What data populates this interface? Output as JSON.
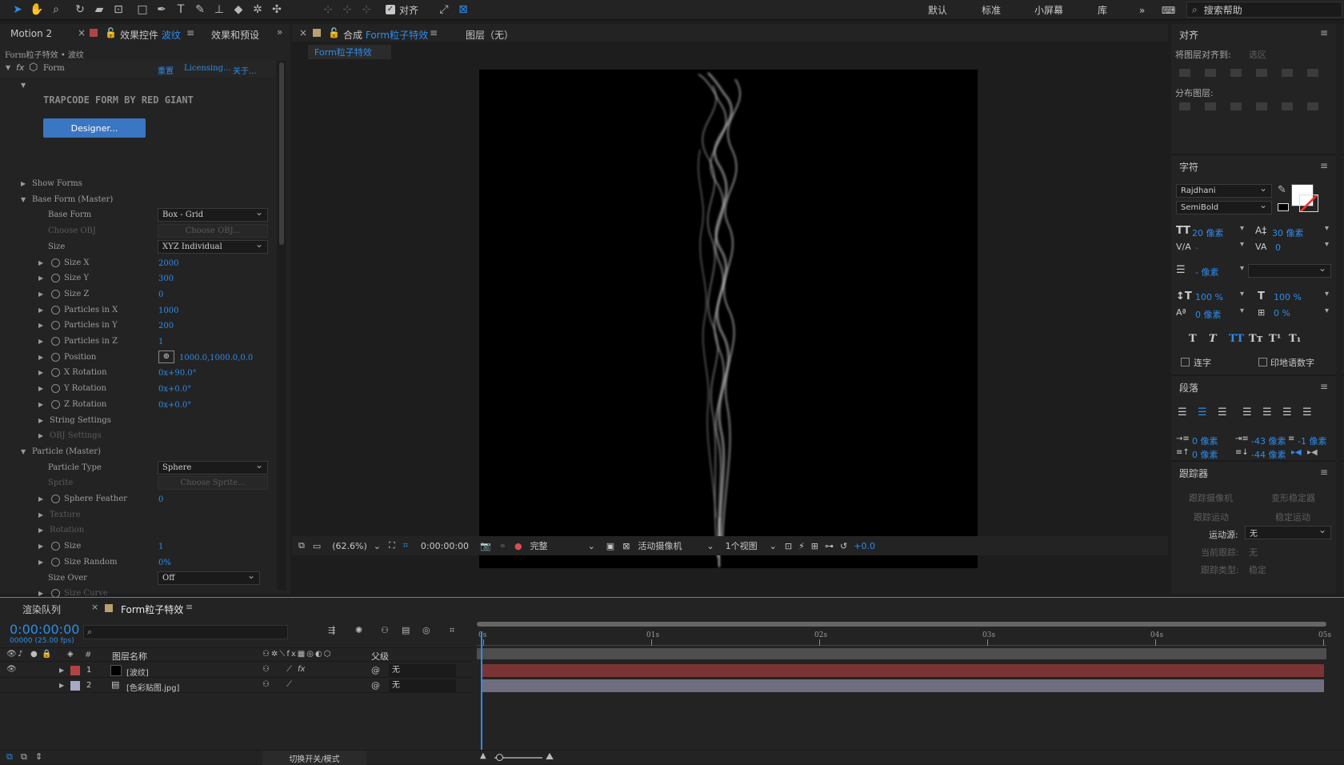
{
  "toolbar": {
    "align_label": "对齐",
    "workspaces": [
      "默认",
      "标准",
      "小屏幕",
      "库"
    ],
    "search_placeholder": "搜索帮助"
  },
  "left_panel": {
    "tab1": "Motion 2",
    "tab2_prefix": "效果控件",
    "tab2_layer": "波纹",
    "tab3": "效果和预设",
    "breadcrumb": "Form粒子特效 • 波纹",
    "effect_name": "Form",
    "reset": "重置",
    "licensing": "Licensing...",
    "about": "关于...",
    "logo_text": "TRAPCODE FORM BY RED GIANT",
    "designer_btn": "Designer...",
    "props": [
      {
        "label": "Show Forms",
        "kind": "group",
        "indent": 1
      },
      {
        "label": "Base Form (Master)",
        "kind": "open",
        "indent": 1
      },
      {
        "label": "Base Form",
        "kind": "dropdown",
        "value": "Box - Grid",
        "indent": 2
      },
      {
        "label": "Choose OBJ",
        "kind": "button",
        "value": "Choose OBJ...",
        "dim": true,
        "indent": 2
      },
      {
        "label": "Size",
        "kind": "dropdown",
        "value": "XYZ Individual",
        "indent": 2
      },
      {
        "label": "Size X",
        "kind": "num",
        "value": "2000",
        "indent": 3
      },
      {
        "label": "Size Y",
        "kind": "num",
        "value": "300",
        "indent": 3
      },
      {
        "label": "Size Z",
        "kind": "num",
        "value": "0",
        "indent": 3
      },
      {
        "label": "Particles in X",
        "kind": "num",
        "value": "1000",
        "indent": 3
      },
      {
        "label": "Particles in Y",
        "kind": "num",
        "value": "200",
        "indent": 3
      },
      {
        "label": "Particles in Z",
        "kind": "num",
        "value": "1",
        "indent": 3
      },
      {
        "label": "Position",
        "kind": "pos",
        "value": "1000.0,1000.0,0.0",
        "indent": 3
      },
      {
        "label": "X Rotation",
        "kind": "num",
        "value": "0x+90.0°",
        "indent": 3
      },
      {
        "label": "Y Rotation",
        "kind": "num",
        "value": "0x+0.0°",
        "indent": 3
      },
      {
        "label": "Z Rotation",
        "kind": "num",
        "value": "0x+0.0°",
        "indent": 3
      },
      {
        "label": "String Settings",
        "kind": "group",
        "indent": 2
      },
      {
        "label": "OBJ Settings",
        "kind": "group",
        "dim": true,
        "indent": 2
      },
      {
        "label": "Particle (Master)",
        "kind": "open",
        "indent": 1
      },
      {
        "label": "Particle Type",
        "kind": "dropdown",
        "value": "Sphere",
        "indent": 2
      },
      {
        "label": "Sprite",
        "kind": "button",
        "value": "Choose Sprite...",
        "dim": true,
        "indent": 2
      },
      {
        "label": "Sphere Feather",
        "kind": "num",
        "value": "0",
        "indent": 3
      },
      {
        "label": "Texture",
        "kind": "group",
        "dim": true,
        "indent": 2
      },
      {
        "label": "Rotation",
        "kind": "group",
        "dim": true,
        "indent": 2
      },
      {
        "label": "Size",
        "kind": "num",
        "value": "1",
        "indent": 3
      },
      {
        "label": "Size Random",
        "kind": "num",
        "value": "0%",
        "indent": 3
      },
      {
        "label": "Size Over",
        "kind": "dropdown",
        "value": "Off",
        "indent": 2
      },
      {
        "label": "Size Curve",
        "kind": "num",
        "value": "",
        "dim": true,
        "indent": 3
      }
    ]
  },
  "comp_panel": {
    "tab_prefix": "合成",
    "tab_name": "Form粒子特效",
    "layer_tab": "图层（无）",
    "sub_tab": "Form粒子特效",
    "zoom": "(62.6%)",
    "timecode": "0:00:00:00",
    "quality": "完整",
    "camera": "活动摄像机",
    "views": "1个视图",
    "exposure": "+0.0"
  },
  "align_panel": {
    "title": "对齐",
    "align_to_label": "将图层对齐到:",
    "align_to_value": "选区",
    "distribute_label": "分布图层:"
  },
  "char_panel": {
    "title": "字符",
    "font": "Rajdhani",
    "style": "SemiBold",
    "size": "20 像素",
    "leading": "30 像素",
    "kerning": "-",
    "tracking": "0",
    "stroke": "- 像素",
    "vscale": "100 %",
    "hscale": "100 %",
    "baseline": "0 像素",
    "tsume": "0 %",
    "ligatures": "连字",
    "hindi": "印地语数字",
    "type_buttons": [
      "T",
      "T",
      "TT",
      "Tт",
      "T¹",
      "T₁"
    ]
  },
  "para_panel": {
    "title": "段落",
    "indent_left": "0 像素",
    "indent_first": "-43 像素",
    "indent_right": "-1 像素",
    "space_before": "0 像素",
    "space_after": "-44 像素"
  },
  "tracker_panel": {
    "title": "跟踪器",
    "track_camera": "跟踪摄像机",
    "warp_stab": "变形稳定器",
    "track_motion": "跟踪运动",
    "stabilize": "稳定运动",
    "source_label": "运动源:",
    "source_value": "无",
    "current_label": "当前跟踪:",
    "current_value": "无",
    "type_label": "跟踪类型:",
    "type_value": "稳定"
  },
  "timeline": {
    "tab_render": "渲染队列",
    "tab_comp": "Form粒子特效",
    "timecode": "0:00:00:00",
    "fps": "00000 (25.00 fps)",
    "col_num": "#",
    "col_name": "图层名称",
    "col_parent": "父级",
    "ruler": [
      "0s",
      "01s",
      "02s",
      "03s",
      "04s",
      "05s"
    ],
    "layers": [
      {
        "num": "1",
        "name": "[波纹]",
        "parent": "无",
        "label_color": "#b04444",
        "bar_color": "#7a3434"
      },
      {
        "num": "2",
        "name": "[色彩贴图.jpg]",
        "parent": "无",
        "label_color": "#a8a8c8",
        "bar_color": "#6e6e80"
      }
    ],
    "switch_mode": "切换开关/模式"
  }
}
